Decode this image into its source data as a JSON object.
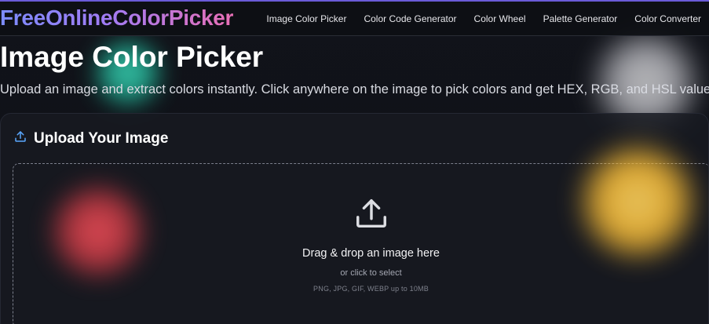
{
  "header": {
    "logo": "FreeOnlineColorPicker",
    "nav": [
      {
        "label": "Image Color Picker"
      },
      {
        "label": "Color Code Generator"
      },
      {
        "label": "Color Wheel"
      },
      {
        "label": "Palette Generator"
      },
      {
        "label": "Color Converter"
      }
    ]
  },
  "hero": {
    "title": "Image Color Picker",
    "subtitle": "Upload an image and extract colors instantly. Click anywhere on the image to pick colors and get HEX, RGB, and HSL values."
  },
  "upload": {
    "icon": "upload-icon",
    "title": "Upload Your Image",
    "dropzone": {
      "icon": "upload-arrow-icon",
      "title": "Drag & drop an image here",
      "subtitle": "or click to select",
      "formats": "PNG, JPG, GIF, WEBP up to 10MB"
    }
  },
  "colors": {
    "accent": "#7c8cff",
    "logo_gradient_end": "#e86fb6",
    "background": "#0e1015",
    "card": "#181a21",
    "icon_blue": "#5aa7ff"
  }
}
